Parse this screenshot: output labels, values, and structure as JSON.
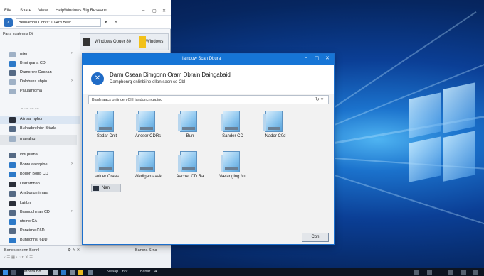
{
  "explorer": {
    "title": "Windows Rig Reseann",
    "menu": [
      "File",
      "Share",
      "View",
      "Help"
    ],
    "address": "Beiinaronn Conts: 10/4rd Beer",
    "nav_window_label": "Windows Opuer 80",
    "nav_window_label2": "Windows",
    "tree_heading": "Fans ccalenns Dir",
    "tree": [
      {
        "label": "mien",
        "icon": "drive-icon"
      },
      {
        "label": "Bnuinpana CD",
        "icon": "drive-icon"
      },
      {
        "label": "Damorcre Casnan",
        "icon": "folder-icon"
      },
      {
        "label": "Dalnbuns ebpin",
        "icon": "folder-icon"
      },
      {
        "label": "Paluarnigma",
        "icon": "folder-icon"
      },
      {
        "label": "Alinsal nphon",
        "icon": "monitor-icon"
      },
      {
        "label": "Bulnarbrelnicr Bitarla",
        "icon": "folder-icon"
      },
      {
        "label": "rnaealng",
        "icon": "disk-icon"
      },
      {
        "label": "lnbl pliana",
        "icon": "disk-icon"
      },
      {
        "label": "Bonnuaainrpine",
        "icon": "drive-icon"
      },
      {
        "label": "Bouon Bopp CD",
        "icon": "drive-icon"
      },
      {
        "label": "Darrarnnan",
        "icon": "drive-icon"
      },
      {
        "label": "Ancbung nimara",
        "icon": "drive-icon"
      },
      {
        "label": "Lairbn",
        "icon": "drive-icon"
      },
      {
        "label": "Bannuuhinan CD",
        "icon": "drive-icon"
      },
      {
        "label": "ntolno CA",
        "icon": "drive-icon"
      },
      {
        "label": "Paneirne C6D",
        "icon": "drive-icon"
      },
      {
        "label": "Bundonnsl 6DD",
        "icon": "drive-icon"
      }
    ],
    "status_left": "Bones olnenn Bonnl",
    "status_right": "Bunsra Srna"
  },
  "dialog": {
    "title": "Iaindow Scan Dbura",
    "heading": "Darm Csean Dimgonn Oram Dbrain Daingabaid",
    "subheading": "Dampbonrg enlinbiine ollan saon co Cbl",
    "address": "Banlinaacs onlincen Cl I landoncrrcpping",
    "drives": [
      {
        "label": "Sedar Dnit"
      },
      {
        "label": "Ancser CDRs"
      },
      {
        "label": "Bun"
      },
      {
        "label": "Sander CD"
      },
      {
        "label": "Nador C0d"
      },
      {
        "label": "soluer Craas"
      },
      {
        "label": "Wedigan aaak"
      },
      {
        "label": "Aacher CD Ra"
      },
      {
        "label": "Welanging Nu"
      }
    ],
    "small_item": "Nan",
    "button": "Con"
  },
  "taskbar": {
    "items": [
      "Mbsra Bd",
      "Neaap Cnnt",
      "Bsnar CA"
    ]
  }
}
